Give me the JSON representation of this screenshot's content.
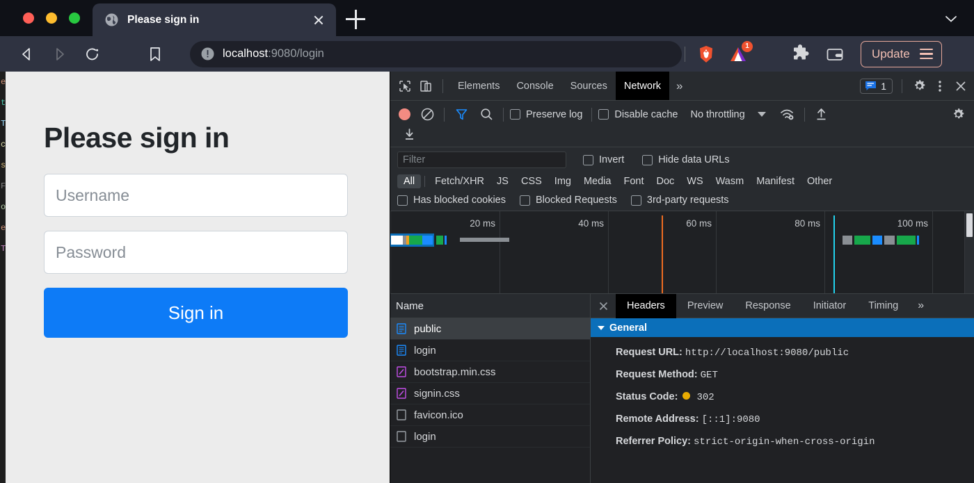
{
  "browser": {
    "window_controls": [
      "close",
      "minimize",
      "maximize"
    ],
    "tab": {
      "title": "Please sign in",
      "favicon": "globe-icon",
      "close_label": "close-tab"
    },
    "new_tab_label": "+",
    "omnibox": {
      "security_icon": "info-circle-icon",
      "host": "localhost",
      "path": ":9080/login"
    },
    "update_button": "Update",
    "rewards_badge_count": "1"
  },
  "page": {
    "title": "Please sign in",
    "username_placeholder": "Username",
    "password_placeholder": "Password",
    "signin_label": "Sign in",
    "accent": "#0d7bf7",
    "code_sliver": [
      "e",
      "t",
      "T",
      "c",
      "s",
      "F",
      "o",
      "e",
      "T"
    ]
  },
  "devtools": {
    "tabs": [
      {
        "label": "Elements",
        "active": false
      },
      {
        "label": "Console",
        "active": false
      },
      {
        "label": "Sources",
        "active": false
      },
      {
        "label": "Network",
        "active": true
      }
    ],
    "more_label": "»",
    "message_count": "1",
    "right_icons": [
      "message-icon",
      "gear-icon",
      "kebab-icon",
      "close-icon"
    ],
    "toolbar": {
      "record_label": "record-button",
      "clear_label": "clear-button",
      "filter_label": "filter-button",
      "search_label": "search-button",
      "preserve_log": "Preserve log",
      "disable_cache": "Disable cache",
      "throttling": "No throttling",
      "icons": [
        "wifi-gear-icon",
        "upload-icon",
        "settings-gear-icon",
        "download-icon"
      ]
    },
    "filterbar": {
      "filter_placeholder": "Filter",
      "invert": "Invert",
      "hide_data_urls": "Hide data URLs",
      "types": [
        "All",
        "Fetch/XHR",
        "JS",
        "CSS",
        "Img",
        "Media",
        "Font",
        "Doc",
        "WS",
        "Wasm",
        "Manifest",
        "Other"
      ],
      "active_type": "All",
      "has_blocked_cookies": "Has blocked cookies",
      "blocked_requests": "Blocked Requests",
      "third_party": "3rd-party requests"
    },
    "timeline": {
      "ticks": [
        "20 ms",
        "40 ms",
        "60 ms",
        "80 ms",
        "100 ms"
      ],
      "dom_content_loaded_color": "#ef6c21",
      "load_color": "#22d3ee"
    },
    "requests": {
      "column_header": "Name",
      "rows": [
        {
          "name": "public",
          "icon": "document-icon",
          "selected": true
        },
        {
          "name": "login",
          "icon": "document-icon",
          "selected": false
        },
        {
          "name": "bootstrap.min.css",
          "icon": "stylesheet-icon",
          "selected": false
        },
        {
          "name": "signin.css",
          "icon": "stylesheet-icon",
          "selected": false
        },
        {
          "name": "favicon.ico",
          "icon": "generic-file-icon",
          "selected": false
        },
        {
          "name": "login",
          "icon": "generic-file-icon",
          "selected": false
        }
      ]
    },
    "detail": {
      "tabs": [
        {
          "label": "Headers",
          "active": true
        },
        {
          "label": "Preview",
          "active": false
        },
        {
          "label": "Response",
          "active": false
        },
        {
          "label": "Initiator",
          "active": false
        },
        {
          "label": "Timing",
          "active": false
        }
      ],
      "more_label": "»",
      "section_title": "General",
      "fields": [
        {
          "key": "Request URL:",
          "value": "http://localhost:9080/public",
          "status": false
        },
        {
          "key": "Request Method:",
          "value": "GET",
          "status": false
        },
        {
          "key": "Status Code:",
          "value": "302",
          "status": true,
          "status_color": "#e8ab02"
        },
        {
          "key": "Remote Address:",
          "value": "[::1]:9080",
          "status": false
        },
        {
          "key": "Referrer Policy:",
          "value": "strict-origin-when-cross-origin",
          "status": false
        }
      ]
    }
  }
}
